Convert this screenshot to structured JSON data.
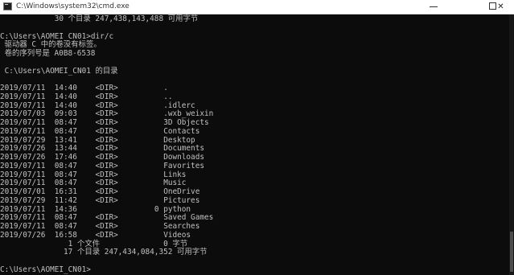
{
  "window": {
    "title": "C:\\Windows\\system32\\cmd.exe",
    "minimize_glyph": "",
    "maximize_glyph": "",
    "close_glyph": "✕"
  },
  "console": {
    "lines": [
      "            30 个目录 247,438,143,488 可用字节",
      "",
      "C:\\Users\\AOMEI_CN01>dir/c",
      " 驱动器 C 中的卷没有标签。",
      " 卷的序列号是 A0B8-6538",
      "",
      " C:\\Users\\AOMEI_CN01 的目录",
      "",
      "2019/07/11  14:40    <DIR>          .",
      "2019/07/11  14:40    <DIR>          ..",
      "2019/07/11  14:40    <DIR>          .idlerc",
      "2019/07/03  09:03    <DIR>          .wxb_weixin",
      "2019/07/11  08:47    <DIR>          3D Objects",
      "2019/07/11  08:47    <DIR>          Contacts",
      "2019/07/29  13:41    <DIR>          Desktop",
      "2019/07/26  13:44    <DIR>          Documents",
      "2019/07/26  17:46    <DIR>          Downloads",
      "2019/07/11  08:47    <DIR>          Favorites",
      "2019/07/11  08:47    <DIR>          Links",
      "2019/07/11  08:47    <DIR>          Music",
      "2019/07/01  16:31    <DIR>          OneDrive",
      "2019/07/29  11:42    <DIR>          Pictures",
      "2019/07/11  14:36                 0 python",
      "2019/07/11  08:47    <DIR>          Saved Games",
      "2019/07/11  08:47    <DIR>          Searches",
      "2019/07/26  16:58    <DIR>          Videos",
      "               1 个文件              0 字节",
      "              17 个目录 247,434,084,352 可用字节",
      "",
      "C:\\Users\\AOMEI_CN01>"
    ]
  },
  "colors": {
    "background": "#0c0c0c",
    "text": "#c0c0c0",
    "titlebar": "#ffffff"
  },
  "icons": {
    "app": "console-app-icon",
    "minimize": "minimize-icon",
    "maximize": "maximize-icon",
    "close": "close-icon"
  }
}
